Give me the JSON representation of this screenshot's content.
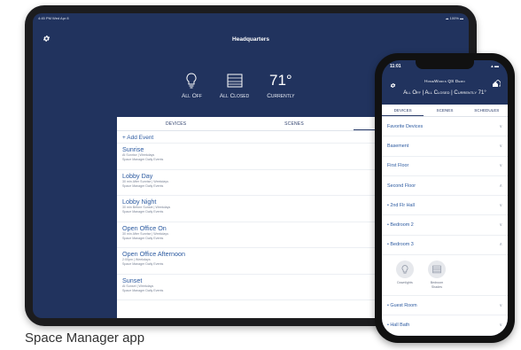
{
  "tablet": {
    "status_left": "4:45 PM  Wed Apr 8",
    "status_right": "☁ 100% ▬",
    "title": "Headquarters",
    "stats": {
      "lights_label": "All Off",
      "shades_label": "All Closed",
      "temperature": "71°",
      "temperature_label": "Currently"
    },
    "tabs": [
      "DEVICES",
      "SCENES",
      "SCHEDULES"
    ],
    "add_event": "+ Add Event",
    "events": [
      {
        "name": "Sunrise",
        "line1": "At Sunrise | Weekdays",
        "line2": "Space Manager Daily Events"
      },
      {
        "name": "Lobby Day",
        "line1": "30 min After Sunrise | Weekdays",
        "line2": "Space Manager Daily Events"
      },
      {
        "name": "Lobby Night",
        "line1": "30 min Before Sunset | Weekdays",
        "line2": "Space Manager Daily Events"
      },
      {
        "name": "Open Office On",
        "line1": "30 min After Sunrise | Weekdays",
        "line2": "Space Manager Daily Events"
      },
      {
        "name": "Open Office Afternoon",
        "line1": "2:00pm | Weekdays",
        "line2": "Space Manager Daily Events"
      },
      {
        "name": "Sunset",
        "line1": "At Sunset | Weekdays",
        "line2": "Space Manager Daily Events"
      }
    ]
  },
  "phone": {
    "time": "11:01",
    "status_right": "▴ ▬",
    "title": "HomeWorks QS Demo",
    "summary": "All Off | All Closed | Currently 71°",
    "tabs": [
      "DEVICES",
      "SCENES",
      "SCHEDULES"
    ],
    "rows_top": [
      "Favorite Devices",
      "Basement",
      "First Floor",
      "Second Floor",
      "• 2nd Flr Hall",
      "• Bedroom 2",
      "• Bedroom 3"
    ],
    "devices": [
      {
        "label": "Downlights",
        "icon": "bulb-icon"
      },
      {
        "label": "Bedroom Shades",
        "icon": "shade-icon"
      }
    ],
    "rows_bottom": [
      "• Guest Room",
      "• Hall Bath"
    ]
  },
  "caption": "Space Manager app",
  "colors": {
    "navy": "#21335e",
    "link": "#2c5aa0",
    "panel": "#ffffff"
  }
}
